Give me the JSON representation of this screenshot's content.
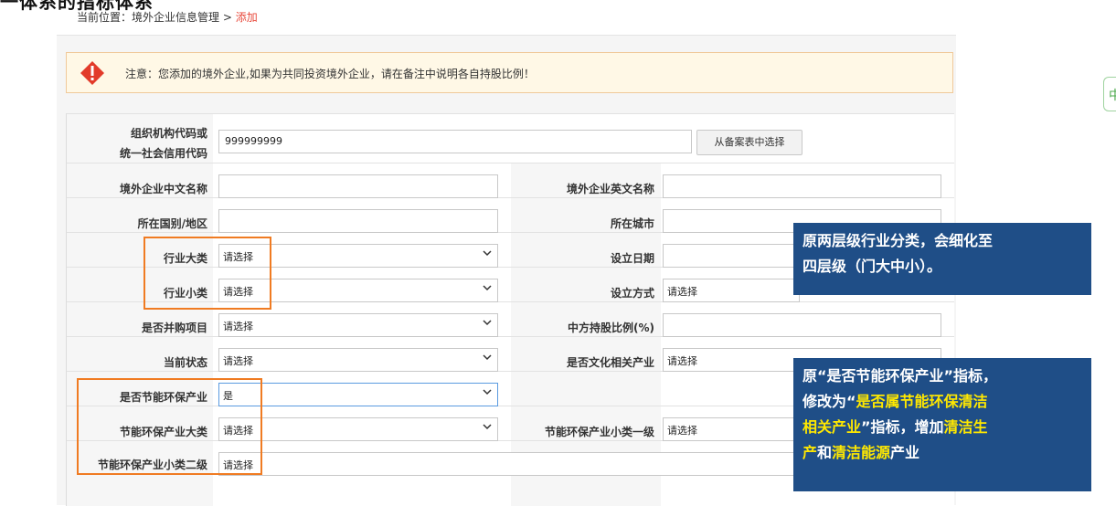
{
  "page": {
    "heading": "一体系的指标体系"
  },
  "breadcrumb": {
    "prefix": "当前位置：境外企业信息管理 > ",
    "current": "添加"
  },
  "notice": {
    "text": "注意：您添加的境外企业,如果为共同投资境外企业，请在备注中说明各自持股比例！"
  },
  "form": {
    "org_code_label_1": "组织机构代码或",
    "org_code_label_2": "统一社会信用代码",
    "org_code_value": "999999999",
    "select_button": "从备案表中选择",
    "cn_name_label": "境外企业中文名称",
    "en_name_label": "境外企业英文名称",
    "country_label": "所在国别/地区",
    "city_label": "所在城市",
    "industry_major_label": "行业大类",
    "industry_major_value": "请选择",
    "setup_date_label": "设立日期",
    "industry_minor_label": "行业小类",
    "industry_minor_value": "请选择",
    "setup_method_label": "设立方式",
    "setup_method_value": "请选择",
    "merger_label": "是否并购项目",
    "merger_value": "请选择",
    "share_ratio_label": "中方持股比例(%)",
    "status_label": "当前状态",
    "status_value": "请选择",
    "culture_label": "是否文化相关产业",
    "culture_value": "请选择",
    "eco_label": "是否节能环保产业",
    "eco_value": "是",
    "eco_major_label": "节能环保产业大类",
    "eco_major_value": "请选择",
    "eco_minor1_label": "节能环保产业小类一级",
    "eco_minor1_value": "请选择",
    "eco_minor2_label": "节能环保产业小类二级",
    "eco_minor2_value": "请选择"
  },
  "callout1": {
    "line1": "原两层级行业分类，会细化至",
    "line2": "四层级（门大中小）。"
  },
  "callout2": {
    "line1": "原“是否节能环保产业”指标，",
    "line2a": "修改为“",
    "line2b": "是否属节能环保清洁",
    "line3a": "相关产业",
    "line3b": "”指标，增加",
    "line3c": "清洁生",
    "line4a": "产",
    "line4b": "和",
    "line4c": "清洁能源",
    "line4d": "产业"
  },
  "side_tab": {
    "text": "中"
  },
  "colors": {
    "highlight": "#f07b22",
    "callout_bg": "#1f4e87",
    "callout_accent": "#ffe800",
    "breadcrumb_current": "#e8493b"
  }
}
